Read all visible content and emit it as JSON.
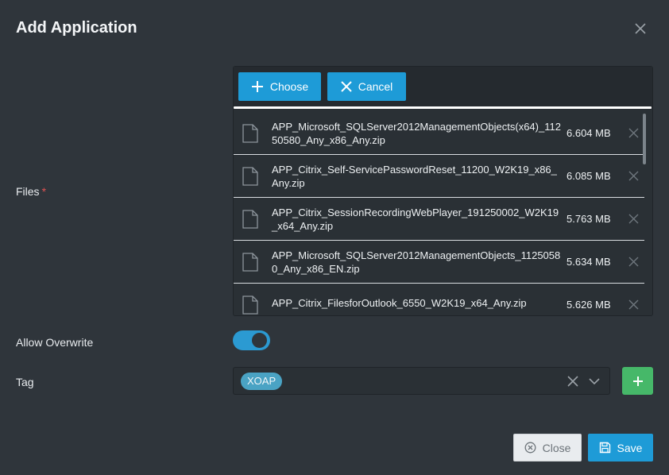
{
  "dialog": {
    "title": "Add Application"
  },
  "labels": {
    "files": "Files",
    "required_mark": "*",
    "allow_overwrite": "Allow Overwrite",
    "tag": "Tag"
  },
  "uploader": {
    "choose_label": "Choose",
    "cancel_label": "Cancel",
    "files": [
      {
        "name": "APP_Microsoft_SQLServer2012ManagementObjects(x64)_11250580_Any_x86_Any.zip",
        "size": "6.604 MB"
      },
      {
        "name": "APP_Citrix_Self-ServicePasswordReset_11200_W2K19_x86_Any.zip",
        "size": "6.085 MB"
      },
      {
        "name": "APP_Citrix_SessionRecordingWebPlayer_191250002_W2K19_x64_Any.zip",
        "size": "5.763 MB"
      },
      {
        "name": "APP_Microsoft_SQLServer2012ManagementObjects_11250580_Any_x86_EN.zip",
        "size": "5.634 MB"
      },
      {
        "name": "APP_Citrix_FilesforOutlook_6550_W2K19_x64_Any.zip",
        "size": "5.626 MB"
      }
    ]
  },
  "allow_overwrite": {
    "enabled": true
  },
  "tag": {
    "selected": [
      "XOAP"
    ]
  },
  "footer": {
    "close_label": "Close",
    "save_label": "Save"
  },
  "colors": {
    "accent": "#1e9bd7",
    "success": "#46b869",
    "background": "#2f353b",
    "required": "#e05252"
  }
}
